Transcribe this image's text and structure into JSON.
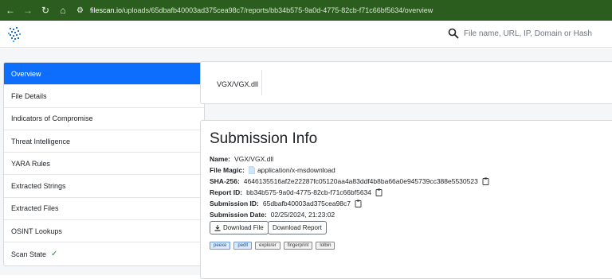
{
  "browser": {
    "url_domain": "filescan.io",
    "url_path": "/uploads/65dbafb40003ad375cea98c7/reports/bb34b575-9a0d-4775-82cb-f71c66bf5634/overview"
  },
  "search": {
    "placeholder": "File name, URL, IP, Domain or Hash"
  },
  "sidebar": {
    "items": [
      {
        "label": "Overview",
        "active": true
      },
      {
        "label": "File Details"
      },
      {
        "label": "Indicators of Compromise"
      },
      {
        "label": "Threat Intelligence"
      },
      {
        "label": "YARA Rules"
      },
      {
        "label": "Extracted Strings"
      },
      {
        "label": "Extracted Files"
      },
      {
        "label": "OSINT Lookups"
      },
      {
        "label": "Scan State",
        "status_icon": "check-icon"
      }
    ]
  },
  "file_card": {
    "name": "VGX/VGX.dll"
  },
  "submission": {
    "title": "Submission Info",
    "name_label": "Name:",
    "name_value": "VGX/VGX.dll",
    "magic_label": "File Magic:",
    "magic_value": "application/x-msdownload",
    "sha_label": "SHA-256:",
    "sha_value": "4646135516af2e22287fc05120aa4a83ddf4b8ba66a0e945739cc388e5530523",
    "report_label": "Report ID:",
    "report_value": "bb34b575-9a0d-4775-82cb-f71c66bf5634",
    "subid_label": "Submission ID:",
    "subid_value": "65dbafb40003ad375cea98c7",
    "date_label": "Submission Date:",
    "date_value": "02/25/2024, 21:23:02",
    "download_file": "Download File",
    "download_report": "Download Report",
    "tags": [
      "peexe",
      "pedll",
      "explorer",
      "fingerprint",
      "lolbin"
    ]
  },
  "colors": {
    "browser_bar": "#2b5e1e",
    "active_item": "#0d6efd",
    "check": "#198754",
    "tag_blue": "#dbe9ff"
  }
}
